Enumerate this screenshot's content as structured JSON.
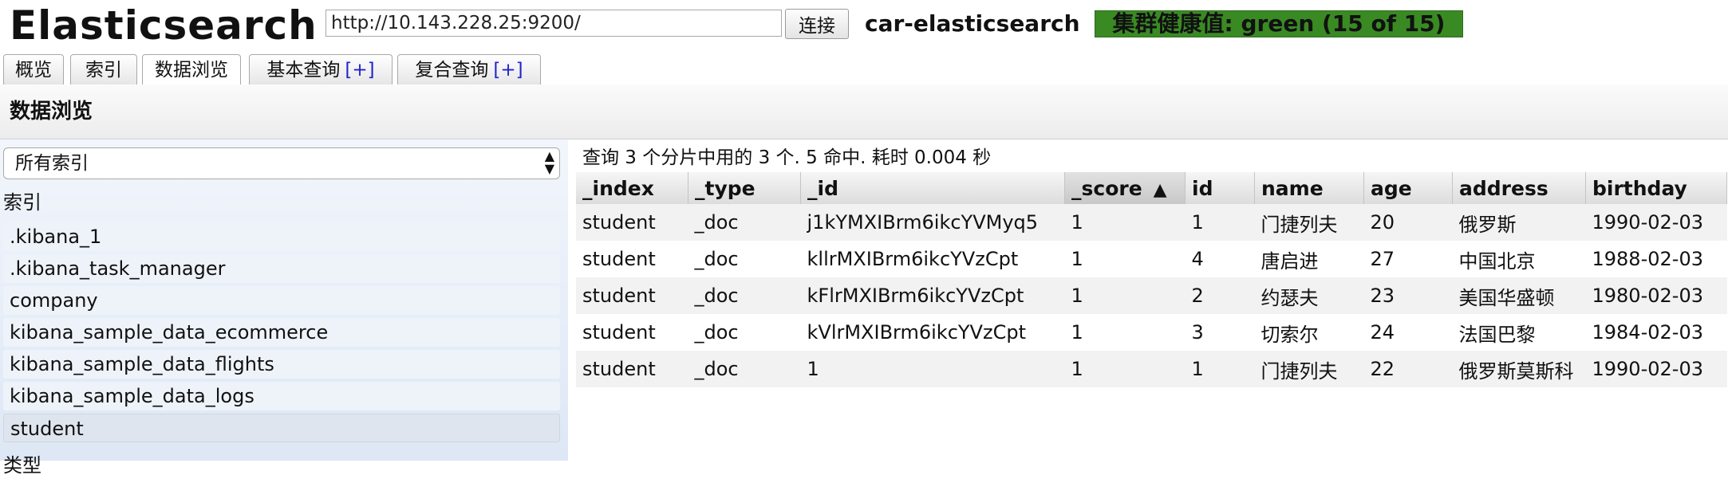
{
  "header": {
    "title": "Elasticsearch",
    "url_value": "http://10.143.228.25:9200/",
    "connect_label": "连接",
    "cluster_name": "car-elasticsearch",
    "health_text": "集群健康值: green (15 of 15)",
    "health_color": "#3a8a24"
  },
  "tabs": [
    {
      "label": "概览",
      "plus": ""
    },
    {
      "label": "索引",
      "plus": ""
    },
    {
      "label": "数据浏览",
      "plus": ""
    },
    {
      "label": "基本查询",
      "plus": "[+]"
    },
    {
      "label": "复合查询",
      "plus": "[+]"
    }
  ],
  "section": {
    "title": "数据浏览"
  },
  "sidebar": {
    "select_value": "所有索引",
    "heading": "索引",
    "indices": [
      ".kibana_1",
      ".kibana_task_manager",
      "company",
      "kibana_sample_data_ecommerce",
      "kibana_sample_data_flights",
      "kibana_sample_data_logs",
      "student"
    ],
    "selected_index": "student",
    "heading2": "类型"
  },
  "results": {
    "summary": "查询 3 个分片中用的 3 个. 5 命中. 耗时 0.004 秒",
    "sort_indicator": "▲",
    "columns": [
      "_index",
      "_type",
      "_id",
      "_score",
      "id",
      "name",
      "age",
      "address",
      "birthday"
    ],
    "sorted_column": "_score",
    "rows": [
      [
        "student",
        "_doc",
        "j1kYMXIBrm6ikcYVMyq5",
        "1",
        "1",
        "门捷列夫",
        "20",
        "俄罗斯",
        "1990-02-03"
      ],
      [
        "student",
        "_doc",
        "kllrMXIBrm6ikcYVzCpt",
        "1",
        "4",
        "唐启进",
        "27",
        "中国北京",
        "1988-02-03"
      ],
      [
        "student",
        "_doc",
        "kFlrMXIBrm6ikcYVzCpt",
        "1",
        "2",
        "约瑟夫",
        "23",
        "美国华盛顿",
        "1980-02-03"
      ],
      [
        "student",
        "_doc",
        "kVlrMXIBrm6ikcYVzCpt",
        "1",
        "3",
        "切索尔",
        "24",
        "法国巴黎",
        "1984-02-03"
      ],
      [
        "student",
        "_doc",
        "1",
        "1",
        "1",
        "门捷列夫",
        "22",
        "俄罗斯莫斯科",
        "1990-02-03"
      ]
    ]
  }
}
